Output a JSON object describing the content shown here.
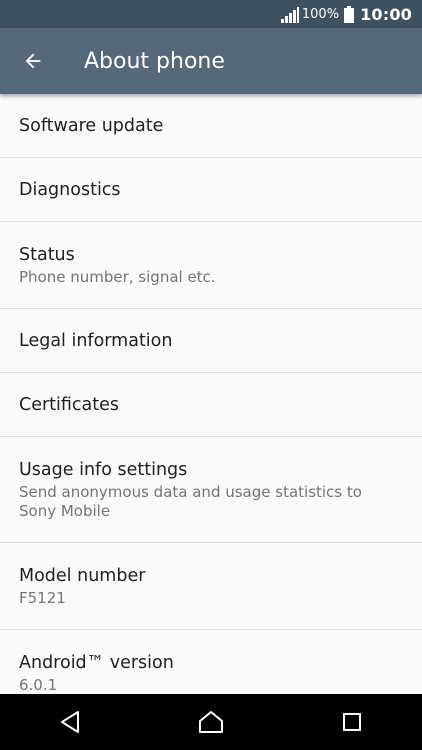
{
  "status_bar": {
    "battery_percent": "100%",
    "time": "10:00",
    "icons": [
      "signal-icon",
      "battery-icon"
    ]
  },
  "app_bar": {
    "title": "About phone",
    "back_icon": "arrow-left-icon"
  },
  "items": [
    {
      "label": "Software update"
    },
    {
      "label": "Diagnostics"
    },
    {
      "label": "Status",
      "sub": "Phone number, signal etc."
    },
    {
      "label": "Legal information"
    },
    {
      "label": "Certificates"
    },
    {
      "label": "Usage info settings",
      "sub": "Send anonymous data and usage statistics to Sony Mobile"
    },
    {
      "label": "Model number",
      "sub": "F5121"
    },
    {
      "label": "Android™ version",
      "sub": "6.0.1"
    }
  ],
  "nav_bar": {
    "icons": [
      "back-triangle-icon",
      "home-icon",
      "recents-icon"
    ]
  },
  "colors": {
    "status_bar": "#3e5160",
    "app_bar": "#56697a",
    "background": "#fafafa",
    "divider": "#dedede",
    "primary_text": "#212121",
    "secondary_text": "#757575",
    "nav_bar": "#000000"
  }
}
